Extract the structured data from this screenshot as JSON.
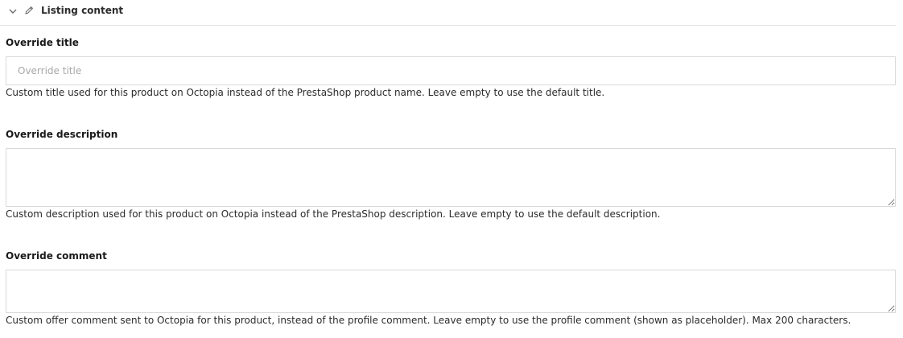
{
  "section": {
    "title": "Listing content",
    "collapse_icon": "chevron-down-icon",
    "edit_icon": "pencil-icon"
  },
  "fields": {
    "title": {
      "label": "Override title",
      "value": "",
      "placeholder": "Override title",
      "help": "Custom title used for this product on Octopia instead of the PrestaShop product name. Leave empty to use the default title."
    },
    "description": {
      "label": "Override description",
      "value": "",
      "placeholder": "",
      "help": "Custom description used for this product on Octopia instead of the PrestaShop description. Leave empty to use the default description."
    },
    "comment": {
      "label": "Override comment",
      "value": "",
      "placeholder": "",
      "help": "Custom offer comment sent to Octopia for this product, instead of the profile comment. Leave empty to use the profile comment (shown as placeholder). Max 200 characters."
    }
  },
  "colors": {
    "border": "#d9d9d9",
    "divider": "#e4e4e4",
    "placeholder": "#a8a8a8"
  }
}
